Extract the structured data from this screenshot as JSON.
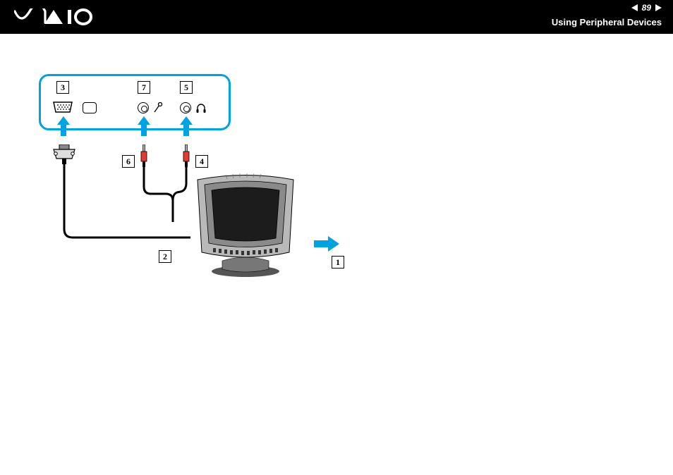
{
  "header": {
    "page_number": "89",
    "section_title": "Using Peripheral Devices"
  },
  "callouts": {
    "c1": "1",
    "c2": "2",
    "c3": "3",
    "c4": "4",
    "c5": "5",
    "c6": "6",
    "c7": "7"
  },
  "colors": {
    "accent": "#00A3E0"
  }
}
